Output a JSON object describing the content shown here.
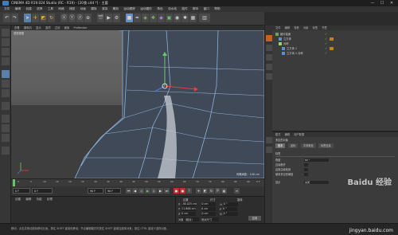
{
  "window": {
    "title": "CINEMA 4D R19.024 Studio (RC - R19) - [20食.c4d *] - 主要",
    "min": "—",
    "max": "☐",
    "close": "✕"
  },
  "menubar": [
    "文件",
    "编辑",
    "创建",
    "选择",
    "工具",
    "网格",
    "捕捉",
    "动画",
    "模拟",
    "渲染",
    "雕刻",
    "运动跟踪",
    "运动图形",
    "角色",
    "流水线",
    "插件",
    "脚本",
    "窗口",
    "帮助"
  ],
  "viewport": {
    "menu": [
      "查看",
      "摄像机",
      "显示",
      "选项",
      "过滤",
      "面板",
      "ProRender"
    ],
    "label": "透视视图",
    "grid_info": "网格间距：100 cm"
  },
  "timeline": {
    "ticks": [
      "0",
      "5",
      "10",
      "15",
      "20",
      "25",
      "30",
      "35",
      "40",
      "45",
      "50",
      "55",
      "60",
      "65",
      "70",
      "75",
      "80",
      "85",
      "90"
    ],
    "end_frame_label": "0 F"
  },
  "transport": {
    "start": "0 F",
    "current": "0 F",
    "end": "90 F",
    "end2": "90 F"
  },
  "material": {
    "menu": [
      "创建",
      "编辑",
      "功能",
      "纹理"
    ]
  },
  "coords": {
    "headers": [
      "位置",
      "尺寸",
      "旋转"
    ],
    "rows": [
      {
        "axis": "X",
        "pos": "-36.025 cm",
        "size": "0 cm",
        "rot_axis": "H",
        "rot": "0 °"
      },
      {
        "axis": "Y",
        "pos": "11.868 cm",
        "size": "0 cm",
        "rot_axis": "P",
        "rot": "0 °"
      },
      {
        "axis": "Z",
        "pos": "0 cm",
        "size": "0 cm",
        "rot_axis": "B",
        "rot": "0 °"
      }
    ],
    "mode": "对象（相对）",
    "mode2": "绝对尺寸",
    "apply": "应用"
  },
  "objects": {
    "menu": [
      "文件",
      "编辑",
      "查看",
      "对象",
      "标签",
      "书签"
    ],
    "rows": [
      {
        "name": "细分曲面",
        "indent": 0
      },
      {
        "name": "立方体",
        "indent": 4
      },
      {
        "name": "对称",
        "indent": 4
      },
      {
        "name": "立方体.1",
        "indent": 8
      },
      {
        "name": "立方体.1 对称",
        "indent": 8
      }
    ]
  },
  "attributes": {
    "menu": [
      "模式",
      "编辑",
      "用户数据"
    ],
    "object_label": "多边形对象",
    "tabs": [
      "基本",
      "坐标",
      "平滑着色",
      "标签信息"
    ],
    "section": "标签",
    "fields": [
      {
        "label": "角度",
        "value": "80 °"
      },
      {
        "label": "边缘断开",
        "value": ""
      },
      {
        "label": "启用边缘检测",
        "value": ""
      },
      {
        "label": "使用多边形阈值",
        "value": ""
      }
    ],
    "extra": "显示",
    "extra_value": "关闭"
  },
  "status": "移动：点击并拖动鼠标移动元素。按住 SHIFT 键量化移动；节点编辑模式时按住 SHIFT 键增加选择对象；按住 CTRL 键减少选择对象。",
  "watermark": {
    "brand": "Baidu 经验",
    "url": "jingyan.baidu.com"
  }
}
